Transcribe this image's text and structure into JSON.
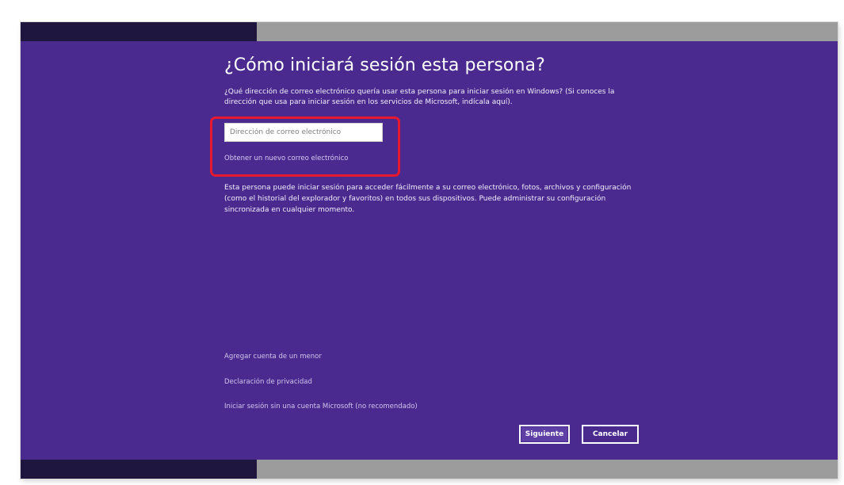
{
  "dialog": {
    "title": "¿Cómo iniciará sesión esta persona?",
    "intro": "¿Qué dirección de correo electrónico quería usar esta persona para iniciar sesión en Windows? (Si conoces la dirección que usa para iniciar sesión en los servicios de Microsoft, indícala aquí).",
    "email_input": {
      "placeholder": "Dirección de correo electrónico",
      "value": ""
    },
    "new_email_link": "Obtener un nuevo correo electrónico",
    "description": "Esta persona puede iniciar sesión para acceder fácilmente a su correo electrónico, fotos, archivos y configuración (como el historial del explorador y favoritos) en todos sus dispositivos. Puede administrar su configuración sincronizada en cualquier momento.",
    "links": {
      "add_child": "Agregar cuenta de un menor",
      "privacy": "Declaración de privacidad",
      "local_account": "Iniciar sesión sin una cuenta Microsoft (no recomendado)"
    },
    "buttons": {
      "next": "Siguiente",
      "cancel": "Cancelar"
    }
  },
  "colors": {
    "background": "#4b2a8f",
    "highlight": "#e8182e",
    "bar_dark": "#1f1640",
    "bar_gray": "#9c9c9c"
  }
}
